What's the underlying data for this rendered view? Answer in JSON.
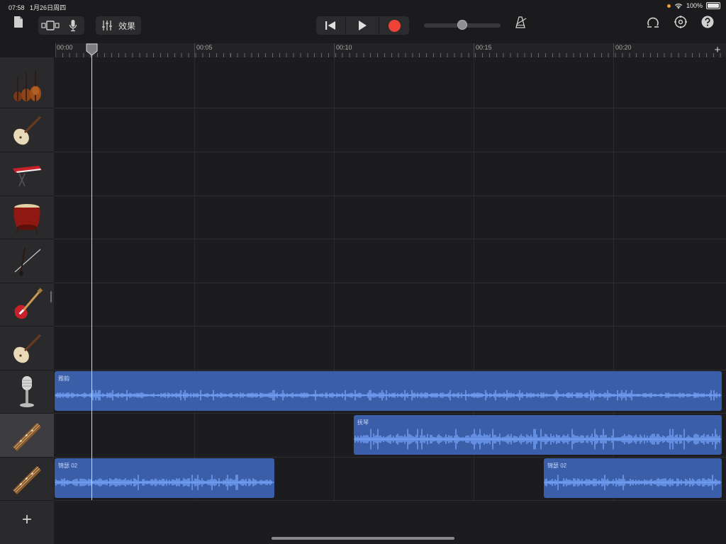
{
  "status_bar": {
    "time": "07:58",
    "date": "1月26日周四",
    "battery": "100%"
  },
  "toolbar": {
    "fx_label": "效果"
  },
  "ruler": {
    "labels": [
      "00:00",
      "00:05",
      "00:10",
      "00:15",
      "00:20"
    ]
  },
  "tracks": [
    {
      "icon": "strings-ensemble-icon"
    },
    {
      "icon": "pipa-icon"
    },
    {
      "icon": "keyboard-icon"
    },
    {
      "icon": "chinese-drum-icon"
    },
    {
      "icon": "erhu-icon"
    },
    {
      "icon": "bass-guitar-icon"
    },
    {
      "icon": "pipa-icon"
    },
    {
      "icon": "microphone-icon",
      "regions": [
        {
          "name": "雅韵",
          "start": 0.0,
          "end": 23.9
        }
      ]
    },
    {
      "icon": "guzheng-icon",
      "selected": true,
      "regions": [
        {
          "name": "抚琴",
          "start": 10.7,
          "end": 23.9
        }
      ]
    },
    {
      "icon": "guzheng-icon",
      "regions": [
        {
          "name": "锦瑟 02",
          "start": 0.0,
          "end": 7.9
        },
        {
          "name": "锦瑟 02",
          "start": 17.5,
          "end": 23.9
        }
      ]
    }
  ],
  "playhead_seconds": 1.3,
  "colors": {
    "region": "#3a5ea8",
    "waveform": "#7aa7ff",
    "record": "#ee4236"
  }
}
